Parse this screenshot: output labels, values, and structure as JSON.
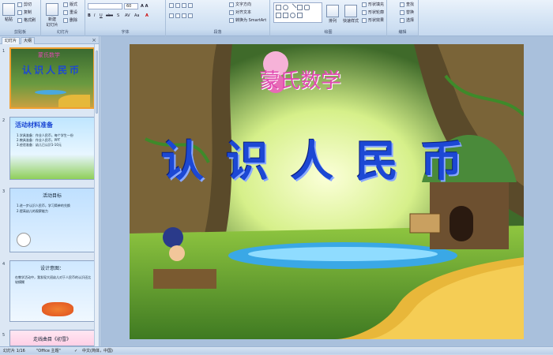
{
  "ribbon": {
    "groups": {
      "clipboard": "剪贴板",
      "slides": "幻灯片",
      "font": "字体",
      "paragraph": "段落",
      "drawing": "绘图",
      "editing": "编辑"
    },
    "clipboard": {
      "paste": "粘贴",
      "cut": "剪切",
      "copy": "复制",
      "format": "格式刷"
    },
    "slides": {
      "new_slide": "新建\n幻灯片",
      "layout": "版式",
      "reset": "重设",
      "delete": "删除"
    },
    "font": {
      "font_name": "",
      "font_size": "60"
    },
    "paragraph": {
      "text_direction": "文字方向",
      "align_text": "对齐文本",
      "smartart": "转换为 SmartArt"
    },
    "drawing": {
      "arrange": "排列",
      "quick_styles": "快速样式",
      "fill": "形状填充",
      "outline": "形状轮廓",
      "effects": "形状效果"
    },
    "editing": {
      "find": "查找",
      "replace": "替换",
      "select": "选择"
    }
  },
  "panel": {
    "tabs": [
      "幻灯片",
      "大纲"
    ],
    "close": "×",
    "slides": [
      {
        "num": "1",
        "title": "认识人民币",
        "sub": "蒙氏数学"
      },
      {
        "num": "2",
        "title": "活动材料准备",
        "lines": [
          "1.学具准备：作业人民币，每个学生一份",
          "2.教具准备：作业人民币，PPT",
          "3.经验准备：幼儿已认识1-10元"
        ]
      },
      {
        "num": "3",
        "title": "活动目标",
        "lines": [
          "1.进一步认识人民币，学习简单的兑换",
          "2.提高幼儿的观察能力"
        ]
      },
      {
        "num": "4",
        "title": "设计意图：",
        "lines": [
          "在教学活动中，我发现大班幼儿对于人民币的认识还比较模糊"
        ]
      },
      {
        "num": "5",
        "title": "走线曲目《初雪》"
      }
    ]
  },
  "slide": {
    "subtitle": "蒙氏数学",
    "title": "认识人民币"
  },
  "status": {
    "page": "幻灯片 1/16",
    "theme": "\"Office 主题\"",
    "lang": "中文(简体，中国)"
  }
}
